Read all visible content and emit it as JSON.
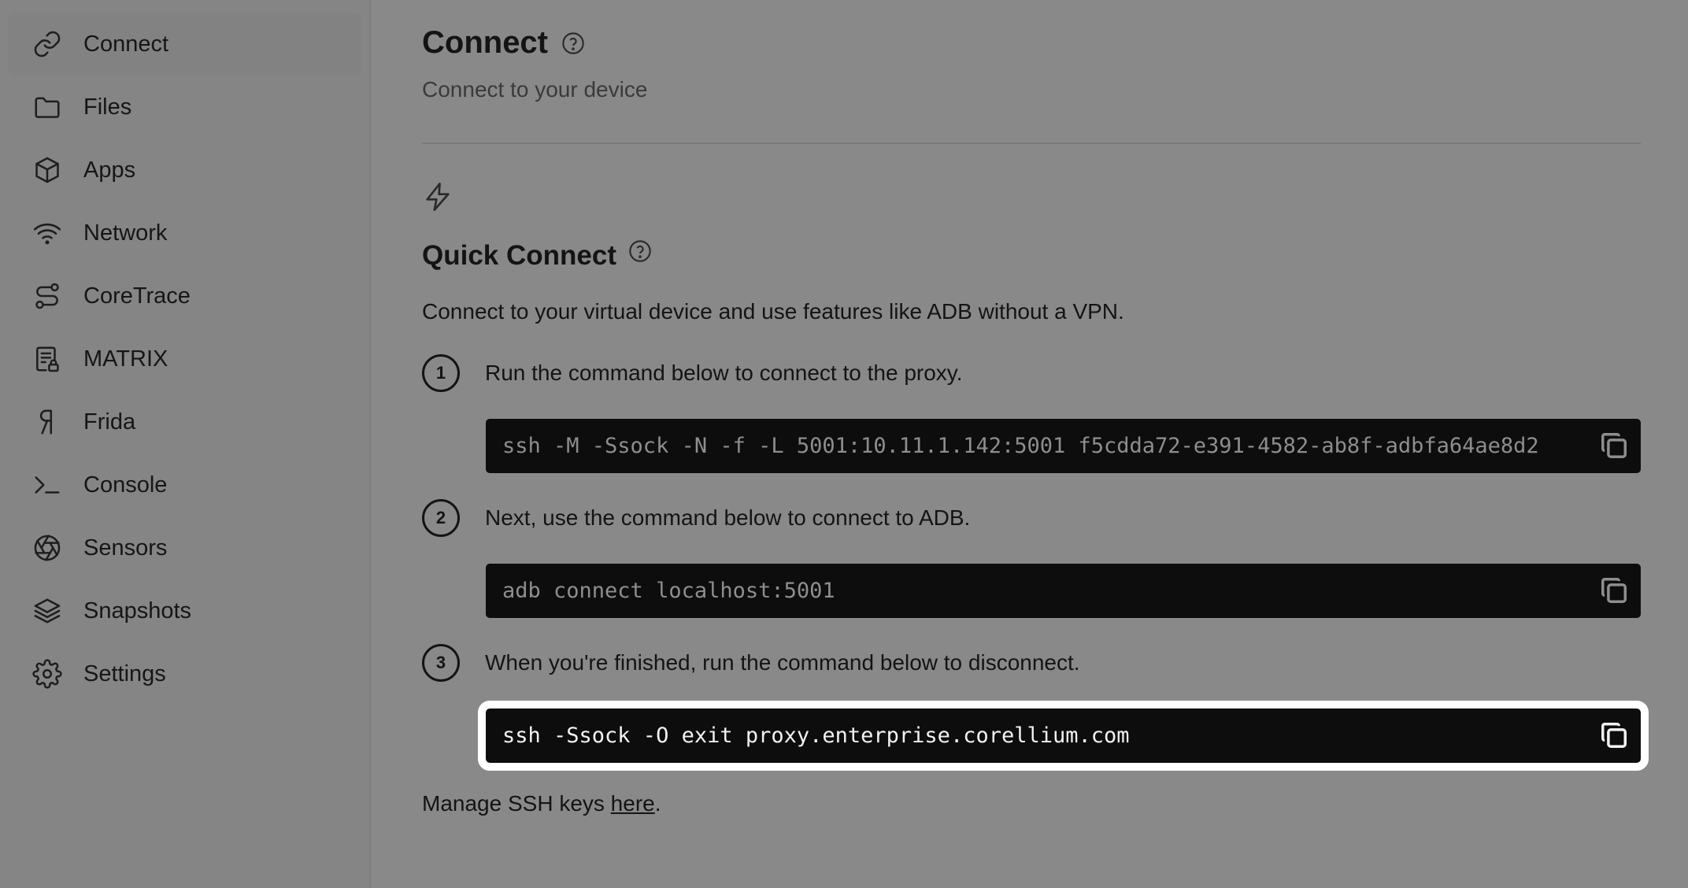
{
  "sidebar": {
    "items": [
      {
        "label": "Connect",
        "icon": "link-icon",
        "active": true
      },
      {
        "label": "Files",
        "icon": "folder-icon"
      },
      {
        "label": "Apps",
        "icon": "cube-icon"
      },
      {
        "label": "Network",
        "icon": "wifi-icon"
      },
      {
        "label": "CoreTrace",
        "icon": "route-icon"
      },
      {
        "label": "MATRIX",
        "icon": "report-lock-icon"
      },
      {
        "label": "Frida",
        "icon": "frida-icon"
      },
      {
        "label": "Console",
        "icon": "terminal-icon"
      },
      {
        "label": "Sensors",
        "icon": "aperture-icon"
      },
      {
        "label": "Snapshots",
        "icon": "layers-icon"
      },
      {
        "label": "Settings",
        "icon": "gear-icon"
      }
    ]
  },
  "header": {
    "title": "Connect",
    "subtitle": "Connect to your device"
  },
  "quick_connect": {
    "title": "Quick Connect",
    "description": "Connect to your virtual device and use features like ADB without a VPN.",
    "steps": [
      {
        "number": "1",
        "text": "Run the command below to connect to the proxy.",
        "command": "ssh -M -Ssock -N -f -L 5001:10.11.1.142:5001 f5cdda72-e391-4582-ab8f-adbfa64ae8d2"
      },
      {
        "number": "2",
        "text": "Next, use the command below to connect to ADB.",
        "command": "adb connect localhost:5001"
      },
      {
        "number": "3",
        "text": "When you're finished, run the command below to disconnect.",
        "command": "ssh -Ssock -O exit proxy.enterprise.corellium.com"
      }
    ],
    "ssh_note_prefix": "Manage SSH keys ",
    "ssh_note_link": "here",
    "ssh_note_suffix": "."
  },
  "colors": {
    "background": "#898989",
    "sidebar": "#858585",
    "code_background": "#0d0d0d",
    "highlight_outline": "#ffffff"
  }
}
